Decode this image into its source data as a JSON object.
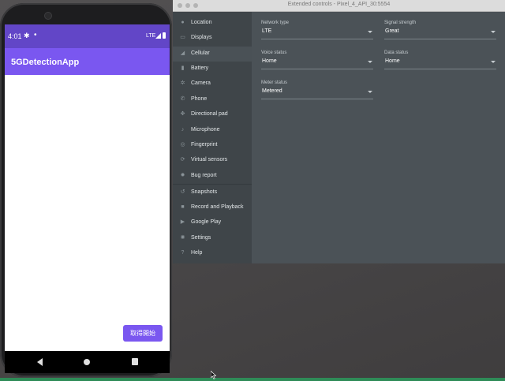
{
  "phone": {
    "status_time": "4:01",
    "status_network": "LTE",
    "app_title": "5GDetectionApp",
    "start_button": "取得開始"
  },
  "window": {
    "title": "Extended controls - Pixel_4_API_30:5554"
  },
  "sidebar": {
    "items": [
      {
        "label": "Location",
        "icon": "location-icon"
      },
      {
        "label": "Displays",
        "icon": "display-icon"
      },
      {
        "label": "Cellular",
        "icon": "cellular-icon"
      },
      {
        "label": "Battery",
        "icon": "battery-icon"
      },
      {
        "label": "Camera",
        "icon": "camera-icon"
      },
      {
        "label": "Phone",
        "icon": "phone-icon"
      },
      {
        "label": "Directional pad",
        "icon": "dpad-icon"
      },
      {
        "label": "Microphone",
        "icon": "microphone-icon"
      },
      {
        "label": "Fingerprint",
        "icon": "fingerprint-icon"
      },
      {
        "label": "Virtual sensors",
        "icon": "sensors-icon"
      },
      {
        "label": "Bug report",
        "icon": "bug-icon"
      },
      {
        "label": "Snapshots",
        "icon": "snapshot-icon"
      },
      {
        "label": "Record and Playback",
        "icon": "record-icon"
      },
      {
        "label": "Google Play",
        "icon": "play-icon"
      },
      {
        "label": "Settings",
        "icon": "gear-icon"
      },
      {
        "label": "Help",
        "icon": "help-icon"
      }
    ],
    "active": "Cellular"
  },
  "cellular": {
    "network_type": {
      "label": "Network type",
      "value": "LTE"
    },
    "signal_strength": {
      "label": "Signal strength",
      "value": "Great"
    },
    "voice_status": {
      "label": "Voice status",
      "value": "Home"
    },
    "data_status": {
      "label": "Data status",
      "value": "Home"
    },
    "meter_status": {
      "label": "Meter status",
      "value": "Metered"
    }
  },
  "colors": {
    "app_primary": "#7a57f0",
    "status_bar": "#6246c7",
    "sidebar_bg": "#3f4549",
    "content_bg": "#4b5257"
  }
}
